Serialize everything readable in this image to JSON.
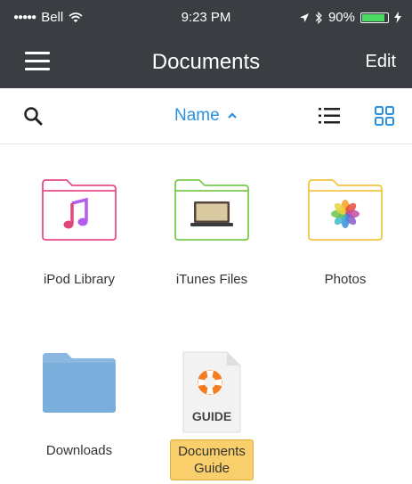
{
  "status_bar": {
    "carrier": "Bell",
    "time": "9:23 PM",
    "battery": "90%",
    "battery_level": 0.9
  },
  "nav": {
    "title": "Documents",
    "edit_label": "Edit"
  },
  "toolbar": {
    "sort_label": "Name",
    "sort_arrow": "^"
  },
  "files": [
    {
      "label": "iPod Library",
      "icon": "music-folder-icon",
      "color": "#e94b8a"
    },
    {
      "label": "iTunes Files",
      "icon": "itunes-folder-icon",
      "color": "#7bc94f"
    },
    {
      "label": "Photos",
      "icon": "photos-folder-icon",
      "color": "#f5c542"
    },
    {
      "label": "Downloads",
      "icon": "downloads-folder-icon",
      "color": "#7aaedb"
    },
    {
      "label": "Documents Guide",
      "label_line1": "Documents",
      "label_line2": "Guide",
      "icon_text": "GUIDE",
      "icon": "lifebuoy-icon",
      "selected": true
    }
  ],
  "colors": {
    "nav_bg": "#3a3d42",
    "accent": "#2a90e0",
    "selected_bg": "#f8cf6a"
  }
}
